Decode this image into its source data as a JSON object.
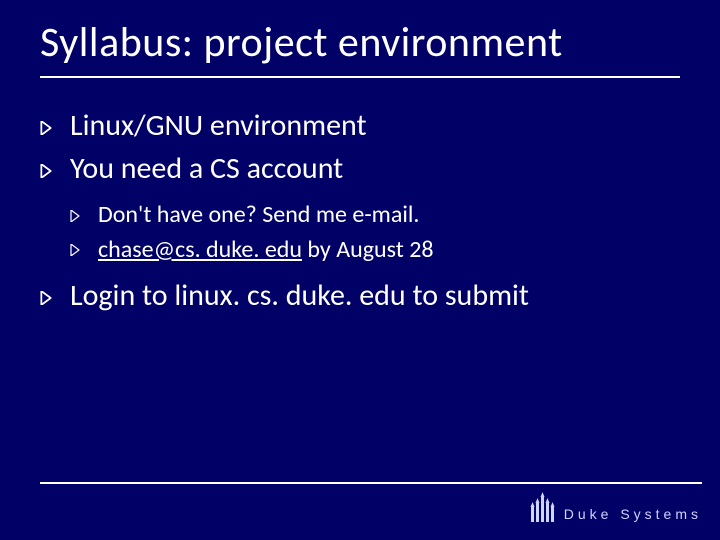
{
  "title": "Syllabus: project environment",
  "bullets": {
    "b0": "Linux/GNU environment",
    "b1": "You need a CS account",
    "b1_sub": {
      "s0": "Don't have one?  Send me e-mail.",
      "s1_link": "chase@cs. duke. edu",
      "s1_tail": " by August 28"
    },
    "b2": "Login to linux. cs. duke. edu to submit"
  },
  "footer": {
    "brand_left": "Duke",
    "brand_right": "Systems"
  }
}
